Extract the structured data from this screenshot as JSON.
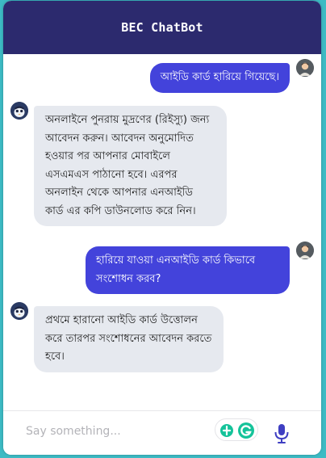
{
  "app": {
    "title": "BEC ChatBot"
  },
  "messages": [
    {
      "sender": "user",
      "lines": [
        "আইডি কার্ড হারিয়ে গিয়েছে।"
      ]
    },
    {
      "sender": "bot",
      "lines": [
        "অনলাইনে পুনরায় মুদ্রণের (রিইস্যু) জন্য",
        "আবেদন করুন। আবেদন অনুমোদিত",
        "হওয়ার পর আপনার মোবাইলে",
        "এসএমএস পাঠানো হবে। এরপর",
        "অনলাইন থেকে আপনার এনআইডি",
        "কার্ড এর কপি ডাউনলোড করে নিন।"
      ]
    },
    {
      "sender": "user",
      "lines": [
        "হারিয়ে যাওয়া এনআইডি কার্ড কিভাবে",
        "সংশোধন করব?"
      ]
    },
    {
      "sender": "bot",
      "lines": [
        "প্রথমে হারানো আইডি কার্ড উত্তোলন",
        "করে তারপর সংশোধনের আবেদন করতে",
        "হবে।"
      ]
    }
  ],
  "composer": {
    "placeholder": "Say something...",
    "value": ""
  },
  "icons": {
    "user_avatar": "user-avatar-icon",
    "bot_avatar": "bot-avatar-icon",
    "grammarly": "grammarly-icon",
    "mic": "microphone-icon"
  },
  "colors": {
    "page_background": "#3dbbc4",
    "header": "#2c2a6e",
    "user_bubble": "#4343db",
    "bot_bubble": "#e6e9ef",
    "mic": "#3f3fc2",
    "grammarly_green": "#15c39a"
  }
}
